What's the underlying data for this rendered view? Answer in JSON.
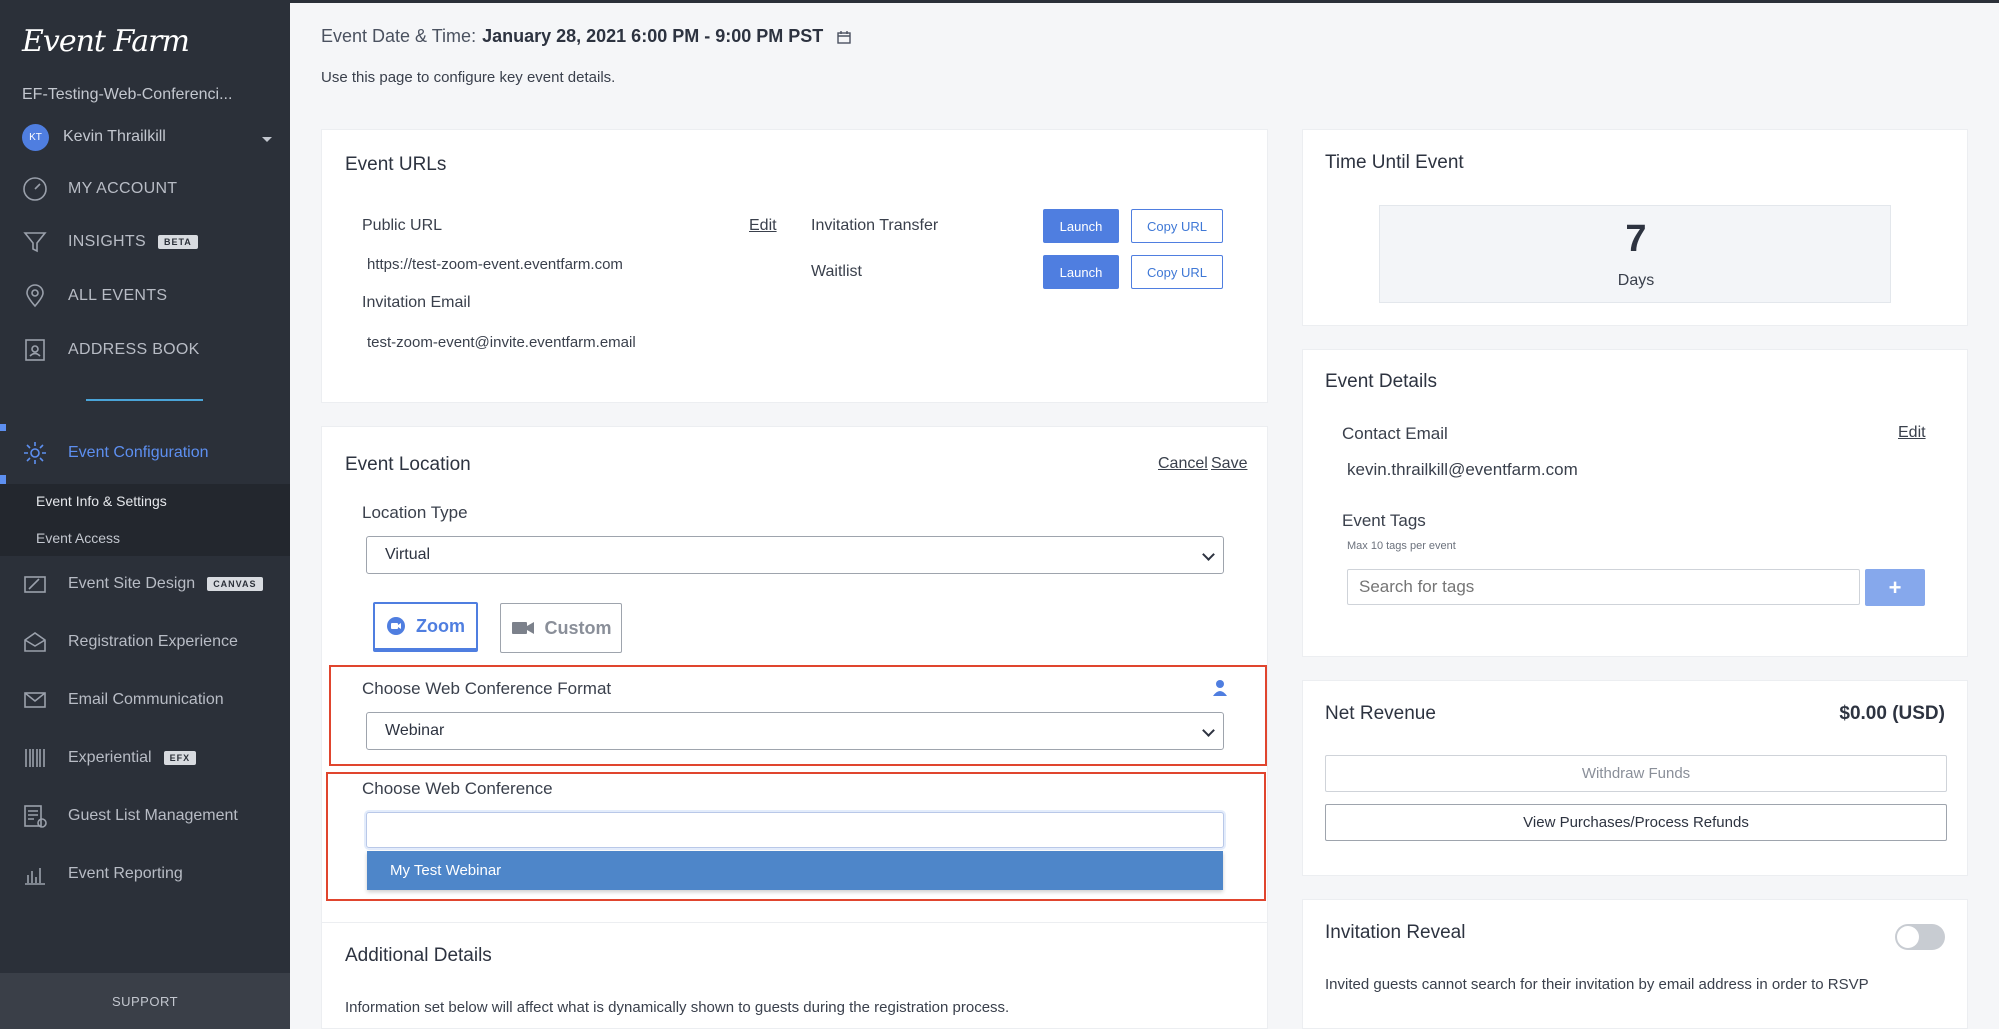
{
  "sidebar": {
    "logo": "Event Farm",
    "event_name": "EF-Testing-Web-Conferenci...",
    "user": {
      "initials": "KT",
      "name": "Kevin Thrailkill"
    },
    "top_items": [
      {
        "label": "MY ACCOUNT"
      },
      {
        "label": "INSIGHTS",
        "badge": "BETA"
      },
      {
        "label": "ALL EVENTS"
      },
      {
        "label": "ADDRESS BOOK"
      }
    ],
    "config_items": [
      {
        "label": "Event Configuration"
      },
      {
        "label": "Event Site Design",
        "badge": "CANVAS"
      },
      {
        "label": "Registration Experience"
      },
      {
        "label": "Email Communication"
      },
      {
        "label": "Experiential",
        "badge": "EFX"
      },
      {
        "label": "Guest List Management"
      },
      {
        "label": "Event Reporting"
      }
    ],
    "subnav": [
      {
        "label": "Event Info & Settings"
      },
      {
        "label": "Event Access"
      }
    ],
    "support_label": "SUPPORT"
  },
  "header": {
    "date_label": "Event Date & Time:",
    "date_value": "January 28, 2021 6:00 PM - 9:00 PM PST",
    "intro": "Use this page to configure key event details."
  },
  "event_urls": {
    "title": "Event URLs",
    "public_url_label": "Public URL",
    "edit_label": "Edit",
    "public_url": "https://test-zoom-event.eventfarm.com",
    "invitation_email_label": "Invitation Email",
    "invitation_email": "test-zoom-event@invite.eventfarm.email",
    "rows": [
      {
        "label": "Invitation Transfer",
        "launch": "Launch",
        "copy": "Copy URL"
      },
      {
        "label": "Waitlist",
        "launch": "Launch",
        "copy": "Copy URL"
      }
    ]
  },
  "event_location": {
    "title": "Event Location",
    "cancel_label": "Cancel",
    "save_label": "Save",
    "location_type_label": "Location Type",
    "location_type_value": "Virtual",
    "tabs": [
      {
        "label": "Zoom"
      },
      {
        "label": "Custom"
      }
    ],
    "format_label": "Choose Web Conference Format",
    "format_value": "Webinar",
    "conference_label": "Choose Web Conference",
    "conference_value": "",
    "dropdown_option": "My Test Webinar"
  },
  "additional_details": {
    "title": "Additional Details",
    "text": "Information set below will affect what is dynamically shown to guests during the registration process."
  },
  "time_until": {
    "title": "Time Until Event",
    "count": "7",
    "unit": "Days"
  },
  "event_details": {
    "title": "Event Details",
    "contact_label": "Contact Email",
    "edit_label": "Edit",
    "contact_email": "kevin.thrailkill@eventfarm.com",
    "tags_label": "Event Tags",
    "tags_hint": "Max 10 tags per event",
    "tags_placeholder": "Search for tags",
    "add_label": "+"
  },
  "net_revenue": {
    "title": "Net Revenue",
    "amount": "$0.00 (USD)",
    "withdraw_label": "Withdraw Funds",
    "purchases_label": "View Purchases/Process Refunds"
  },
  "invitation_reveal": {
    "title": "Invitation Reveal",
    "enabled": false,
    "text": "Invited guests cannot search for their invitation by email address in order to RSVP"
  },
  "colors": {
    "sidebar_bg": "#2b3039",
    "accent": "#4f7ee0",
    "highlight_box": "#e0452e",
    "link": "#3f78d6"
  }
}
